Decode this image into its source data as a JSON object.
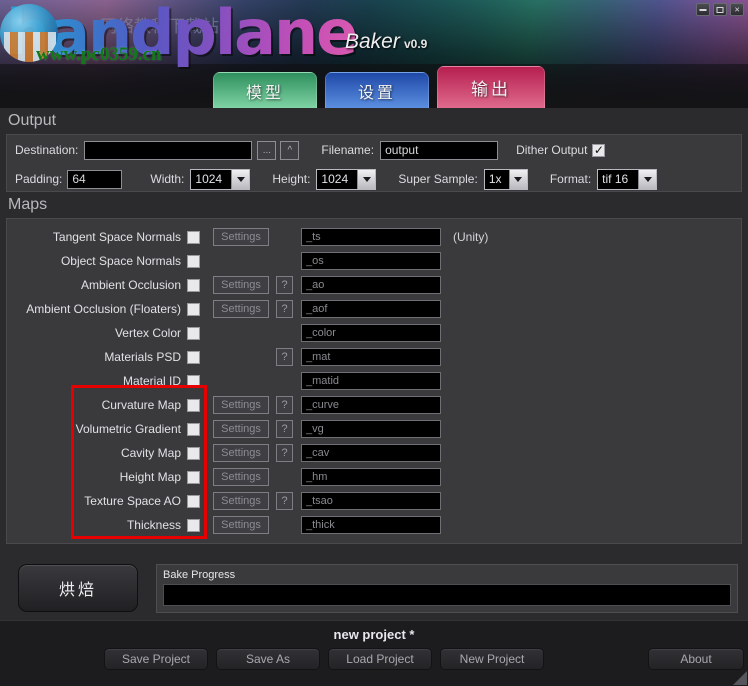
{
  "window": {
    "title_logo": "handplane",
    "product": "Baker",
    "version": "v0.9",
    "watermark": "www.pc0359.cn",
    "watermark_cn": "网络教程下载站",
    "controls": {
      "minimize": "minimize-icon",
      "maximize": "maximize-icon",
      "close": "×"
    }
  },
  "tabs": [
    {
      "label": "模型",
      "name": "tab-model",
      "color": "#3aa06a",
      "active": false
    },
    {
      "label": "设置",
      "name": "tab-settings",
      "color": "#2a58b8",
      "active": false
    },
    {
      "label": "输出",
      "name": "tab-output",
      "color": "#c32a58",
      "active": true
    }
  ],
  "output": {
    "section_title": "Output",
    "destination_label": "Destination:",
    "destination_value": "",
    "browse_button": "...",
    "up_button": "^",
    "filename_label": "Filename:",
    "filename_value": "output",
    "dither_label": "Dither Output",
    "dither_checked": true,
    "padding_label": "Padding:",
    "padding_value": "64",
    "width_label": "Width:",
    "width_value": "1024",
    "height_label": "Height:",
    "height_value": "1024",
    "supersample_label": "Super Sample:",
    "supersample_value": "1x",
    "format_label": "Format:",
    "format_value": "tif 16"
  },
  "maps": {
    "section_title": "Maps",
    "settings_label": "Settings",
    "help_label": "?",
    "unity_note": "(Unity)",
    "highlight_color": "#e60000",
    "rows": [
      {
        "name": "Tangent Space Normals",
        "checked": false,
        "has_settings": true,
        "has_help": false,
        "suffix": "_ts",
        "note": "(Unity)"
      },
      {
        "name": "Object Space Normals",
        "checked": false,
        "has_settings": false,
        "has_help": false,
        "suffix": "_os",
        "note": ""
      },
      {
        "name": "Ambient Occlusion",
        "checked": false,
        "has_settings": true,
        "has_help": true,
        "suffix": "_ao",
        "note": ""
      },
      {
        "name": "Ambient Occlusion (Floaters)",
        "checked": false,
        "has_settings": true,
        "has_help": true,
        "suffix": "_aof",
        "note": ""
      },
      {
        "name": "Vertex Color",
        "checked": false,
        "has_settings": false,
        "has_help": false,
        "suffix": "_color",
        "note": ""
      },
      {
        "name": "Materials PSD",
        "checked": false,
        "has_settings": false,
        "has_help": true,
        "suffix": "_mat",
        "note": ""
      },
      {
        "name": "Material ID",
        "checked": false,
        "has_settings": false,
        "has_help": false,
        "suffix": "_matid",
        "note": ""
      },
      {
        "name": "Curvature Map",
        "checked": false,
        "has_settings": true,
        "has_help": true,
        "suffix": "_curve",
        "note": ""
      },
      {
        "name": "Volumetric Gradient",
        "checked": false,
        "has_settings": true,
        "has_help": true,
        "suffix": "_vg",
        "note": ""
      },
      {
        "name": "Cavity Map",
        "checked": false,
        "has_settings": true,
        "has_help": true,
        "suffix": "_cav",
        "note": ""
      },
      {
        "name": "Height Map",
        "checked": false,
        "has_settings": true,
        "has_help": false,
        "suffix": "_hm",
        "note": ""
      },
      {
        "name": "Texture Space AO",
        "checked": false,
        "has_settings": true,
        "has_help": true,
        "suffix": "_tsao",
        "note": ""
      },
      {
        "name": "Thickness",
        "checked": false,
        "has_settings": true,
        "has_help": false,
        "suffix": "_thick",
        "note": ""
      }
    ]
  },
  "bake": {
    "button_label": "烘焙",
    "progress_label": "Bake Progress",
    "progress_percent": 0
  },
  "footer": {
    "project_name": "new project *",
    "buttons": [
      {
        "label": "Save Project",
        "name": "save-project-button"
      },
      {
        "label": "Save As",
        "name": "save-as-button"
      },
      {
        "label": "Load Project",
        "name": "load-project-button"
      },
      {
        "label": "New Project",
        "name": "new-project-button"
      }
    ],
    "about_label": "About"
  }
}
